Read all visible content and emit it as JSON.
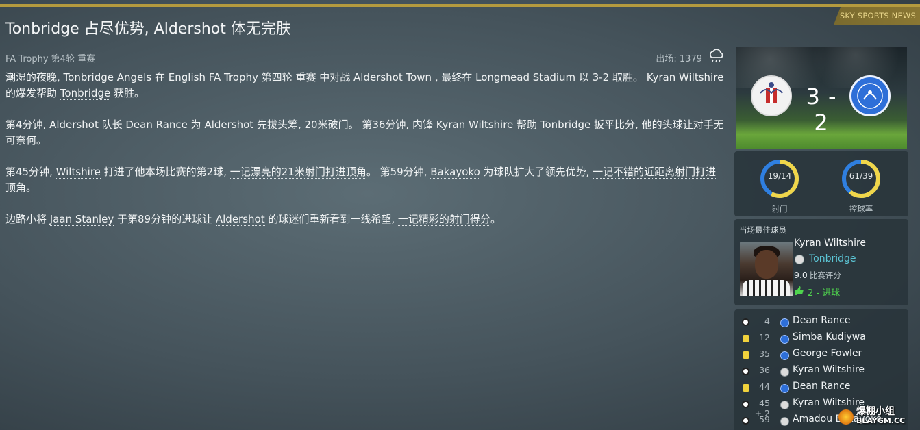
{
  "header": {
    "source": "SKY SPORTS NEWS",
    "headline": "Tonbridge 占尽优势, Aldershot 体无完肤",
    "competition": "FA Trophy 第4轮 重赛",
    "attendance": "出场: 1379",
    "weather_icon": "rain-cloud-icon"
  },
  "article": {
    "p1": [
      {
        "t": "潮湿的夜晚, ",
        "link": false
      },
      {
        "t": "Tonbridge Angels",
        "link": true
      },
      {
        "t": " 在 ",
        "link": false
      },
      {
        "t": "English FA Trophy",
        "link": true
      },
      {
        "t": " 第四轮 ",
        "link": false
      },
      {
        "t": "重赛",
        "link": true
      },
      {
        "t": " 中对战 ",
        "link": false
      },
      {
        "t": "Aldershot Town",
        "link": true
      },
      {
        "t": " , 最终在 ",
        "link": false
      },
      {
        "t": "Longmead Stadium",
        "link": true
      },
      {
        "t": " 以 ",
        "link": false
      },
      {
        "t": "3-2",
        "link": true
      },
      {
        "t": " 取胜。 ",
        "link": false
      },
      {
        "t": "Kyran Wiltshire",
        "link": true
      },
      {
        "t": " 的爆发帮助 ",
        "link": false
      },
      {
        "t": "Tonbridge",
        "link": true
      },
      {
        "t": " 获胜。",
        "link": false
      }
    ],
    "p2": [
      {
        "t": "第4分钟, ",
        "link": false
      },
      {
        "t": "Aldershot",
        "link": true
      },
      {
        "t": " 队长 ",
        "link": false
      },
      {
        "t": "Dean Rance",
        "link": true
      },
      {
        "t": " 为 ",
        "link": false
      },
      {
        "t": "Aldershot",
        "link": true
      },
      {
        "t": " 先拔头筹, ",
        "link": false
      },
      {
        "t": "20米破门",
        "link": true
      },
      {
        "t": "。 第36分钟, 内锋 ",
        "link": false
      },
      {
        "t": "Kyran Wiltshire",
        "link": true
      },
      {
        "t": " 帮助 ",
        "link": false
      },
      {
        "t": "Tonbridge",
        "link": true
      },
      {
        "t": " 扳平比分, 他的头球让对手无可奈何。",
        "link": false
      }
    ],
    "p3": [
      {
        "t": "第45分钟, ",
        "link": false
      },
      {
        "t": "Wiltshire",
        "link": true
      },
      {
        "t": " 打进了他本场比赛的第2球, ",
        "link": false
      },
      {
        "t": "一记漂亮的21米射门打进顶角",
        "link": true
      },
      {
        "t": "。 第59分钟, ",
        "link": false
      },
      {
        "t": "Bakayoko",
        "link": true
      },
      {
        "t": " 为球队扩大了领先优势, ",
        "link": false
      },
      {
        "t": "一记不错的近距离射门打进顶角",
        "link": true
      },
      {
        "t": "。",
        "link": false
      }
    ],
    "p4": [
      {
        "t": "边路小将 ",
        "link": false
      },
      {
        "t": "Jaan Stanley",
        "link": true
      },
      {
        "t": " 于第89分钟的进球让 ",
        "link": false
      },
      {
        "t": "Aldershot",
        "link": true
      },
      {
        "t": " 的球迷们重新看到一线希望, ",
        "link": false
      },
      {
        "t": "一记精彩的射门得分",
        "link": true
      },
      {
        "t": "。",
        "link": false
      }
    ]
  },
  "score": {
    "text": "3 - 2",
    "home_crest": "tonbridge-crest-icon",
    "away_crest": "aldershot-crest-icon"
  },
  "stats": [
    {
      "value": "19/14",
      "label": "射门",
      "home_fraction": 0.576
    },
    {
      "value": "61/39",
      "label": "控球率",
      "home_fraction": 0.61
    }
  ],
  "motm": {
    "title": "当场最佳球员",
    "name": "Kyran Wiltshire",
    "club": "Tonbridge",
    "rating": "9.0",
    "rating_label": "比赛评分",
    "goals": "2 - 进球"
  },
  "events": [
    {
      "type": "goal",
      "minute": "4",
      "side": "away",
      "player": "Dean Rance"
    },
    {
      "type": "yellow",
      "minute": "12",
      "side": "away",
      "player": "Simba Kudiywa"
    },
    {
      "type": "yellow",
      "minute": "35",
      "side": "away",
      "player": "George Fowler"
    },
    {
      "type": "goal",
      "minute": "36",
      "side": "home",
      "player": "Kyran Wiltshire"
    },
    {
      "type": "yellow",
      "minute": "44",
      "side": "away",
      "player": "Dean Rance"
    },
    {
      "type": "goal",
      "minute": "45 + 2",
      "side": "home",
      "player": "Kyran Wiltshire"
    },
    {
      "type": "goal",
      "minute": "59",
      "side": "home",
      "player": "Amadou Bakayoko"
    }
  ],
  "watermark": {
    "text": "爆棚小组",
    "sub": "BLAYGM.CC"
  },
  "colors": {
    "accent_gold": "#b49a3e",
    "ring_home": "#f0d64a",
    "ring_away": "#2f7fe0",
    "club_link": "#5cc6d6",
    "goals_green": "#4fd44e"
  }
}
